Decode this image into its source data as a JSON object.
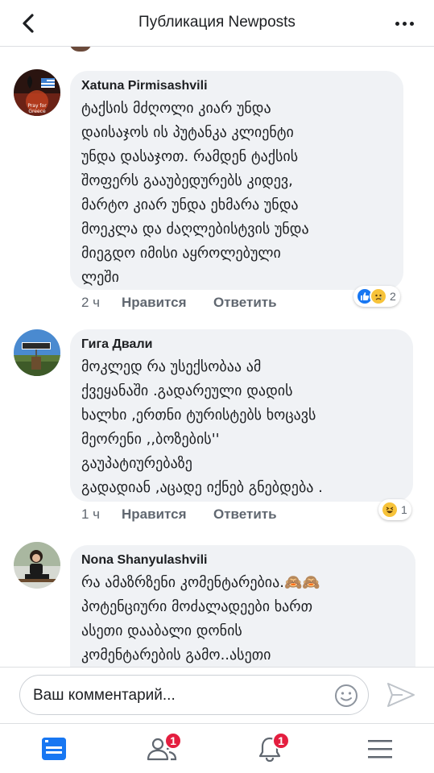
{
  "header": {
    "title": "Публикация Newposts",
    "back_icon": "chevron-left-icon",
    "more_icon": "more-horizontal-icon"
  },
  "comments": [
    {
      "author": "Xatuna Pirmisashvili",
      "text": "ტაქსის მძღოლი კიარ უნდა\nდაისაჯოს ის პუტანკა კლიენტი\nუნდა დასაჯოთ.  რამდენ ტაქსის\nშოფერს გააუბედურებს კიდევ,\nმარტო კიარ უნდა ეხმარა უნდა\nმოეკლა და ძაღლებისტვის უნდა\nმიეგდო იმისი აყროლებული\nლეში",
      "time": "2 ч",
      "like_label": "Нравится",
      "reply_label": "Ответить",
      "reaction_count": "2",
      "reactions": [
        "like",
        "sad"
      ],
      "avatar_text": "Pray for\nGreece"
    },
    {
      "author": "Гига Двали",
      "text": "მოკლედ რა უსექსობაა ამ\nქვეყანაში .გადარეული დადის\nხალხი ,ერთნი ტურისტებს ხოცავს\nმეორენი  ,,ბოზების''\nგაუპატიურებაზე\nგადადიან ,აცადე იქნებ გნებდება .",
      "time": "1 ч",
      "like_label": "Нравится",
      "reply_label": "Ответить",
      "reaction_count": "1",
      "reactions": [
        "haha"
      ]
    },
    {
      "author": "Nona Shanyulashvili",
      "text": "რა ამაზრზენი კომენტარებია.🙈🙈\nპოტენციური მოძალადეები ხართ\nასეთი დააბალი დონის\nკომენტარების გამო..ასეთი"
    }
  ],
  "composer": {
    "placeholder": "Ваш комментарий..."
  },
  "tabbar": {
    "items": [
      {
        "name": "news-feed",
        "icon": "news-feed-icon",
        "badge": ""
      },
      {
        "name": "friends",
        "icon": "friends-icon",
        "badge": "1"
      },
      {
        "name": "notifications",
        "icon": "bell-icon",
        "badge": "1"
      },
      {
        "name": "menu",
        "icon": "hamburger-menu-icon",
        "badge": ""
      }
    ]
  },
  "colors": {
    "accent": "#1877f2",
    "badge": "#e41e3f",
    "bubble": "#f0f2f5",
    "meta": "#606770"
  }
}
